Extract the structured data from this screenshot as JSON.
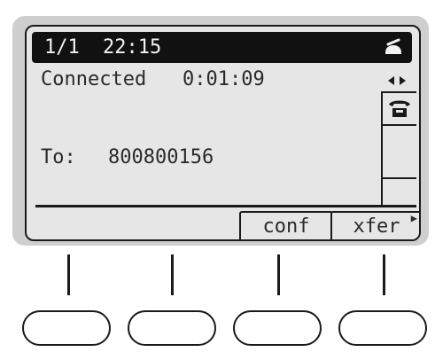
{
  "status_bar": {
    "line_count": "1/1",
    "time": "22:15",
    "status_icon": "handset-icon"
  },
  "call": {
    "state": "Connected",
    "duration": "0:01:09",
    "destination_label": "To:",
    "destination_number": "800800156"
  },
  "side_panel": {
    "scroll_icon": "left-right-arrows-icon",
    "line_icon": "phone-icon"
  },
  "softkeys": [
    {
      "label": ""
    },
    {
      "label": ""
    },
    {
      "label": "conf"
    },
    {
      "label": "xfer"
    }
  ],
  "colors": {
    "lcd_background": "#e6e6e6",
    "lcd_ink": "#1a1a1a",
    "bezel": "#cfcfcf"
  }
}
